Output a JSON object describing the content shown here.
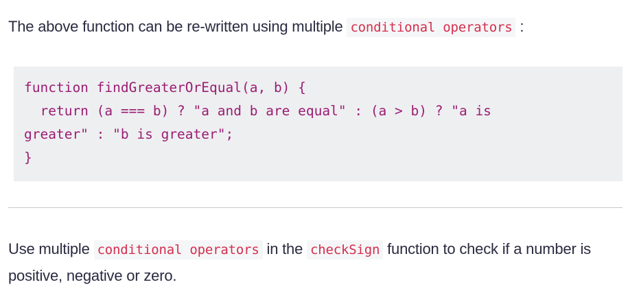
{
  "intro": {
    "before": "The above function can be re-written using multiple ",
    "code": "conditional operators",
    "after": " :"
  },
  "code_block": {
    "lines": [
      "function findGreaterOrEqual(a, b) {",
      "  return (a === b) ? \"a and b are equal\" : (a > b) ? \"a is",
      "greater\" : \"b is greater\";",
      "}"
    ]
  },
  "instruction": {
    "part1": "Use multiple ",
    "code1": "conditional operators",
    "part2": " in the ",
    "code2": "checkSign",
    "part3": " function to check if a number is positive, negative or zero."
  }
}
